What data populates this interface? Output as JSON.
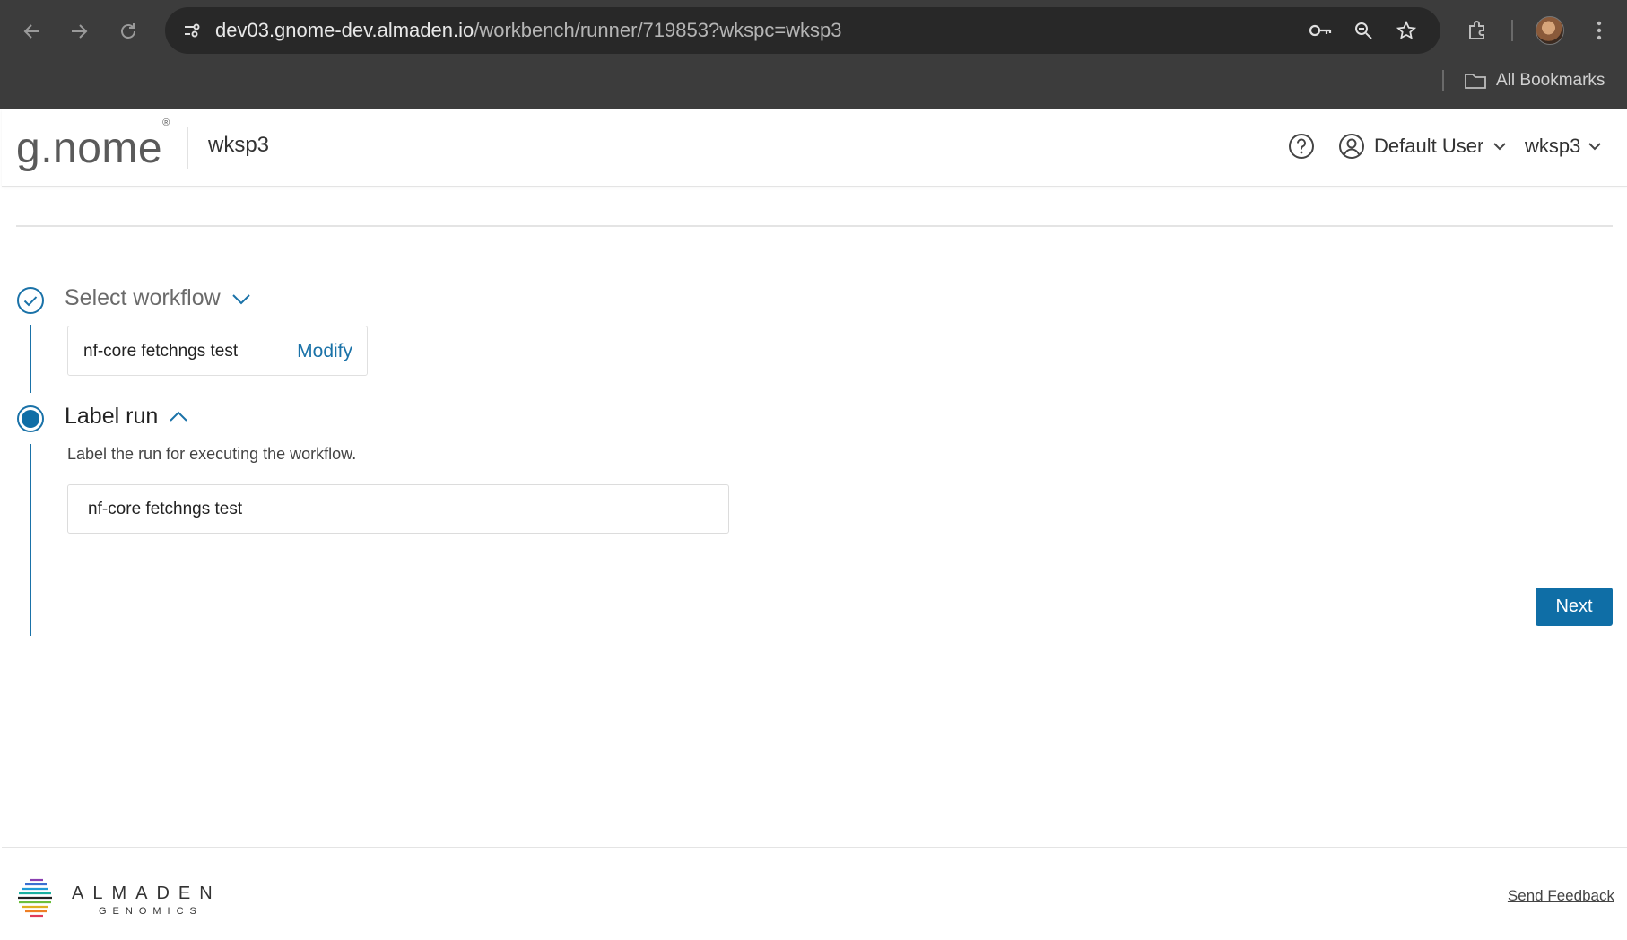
{
  "browser": {
    "url_host": "dev03.gnome-dev.almaden.io",
    "url_path": "/workbench/runner/719853?wkspc=wksp3",
    "bookmarks_label": "All Bookmarks"
  },
  "header": {
    "logo_text": "g.nome",
    "logo_mark": "®",
    "workspace_title": "wksp3",
    "user_label": "Default User",
    "workspace_menu_label": "wksp3"
  },
  "steps": [
    {
      "title": "Select workflow",
      "status": "complete",
      "selected_workflow": "nf-core fetchngs test",
      "modify_label": "Modify"
    },
    {
      "title": "Label run",
      "status": "active",
      "description": "Label the run for executing the workflow.",
      "input_value": "nf-core fetchngs test"
    }
  ],
  "actions": {
    "next_label": "Next"
  },
  "footer": {
    "brand": "ALMADEN",
    "brand_sub": "GENOMICS",
    "feedback_label": "Send Feedback"
  },
  "colors": {
    "accent": "#0f6ea6",
    "link": "#1a72a8",
    "chrome_bg": "#3c3c3c"
  }
}
